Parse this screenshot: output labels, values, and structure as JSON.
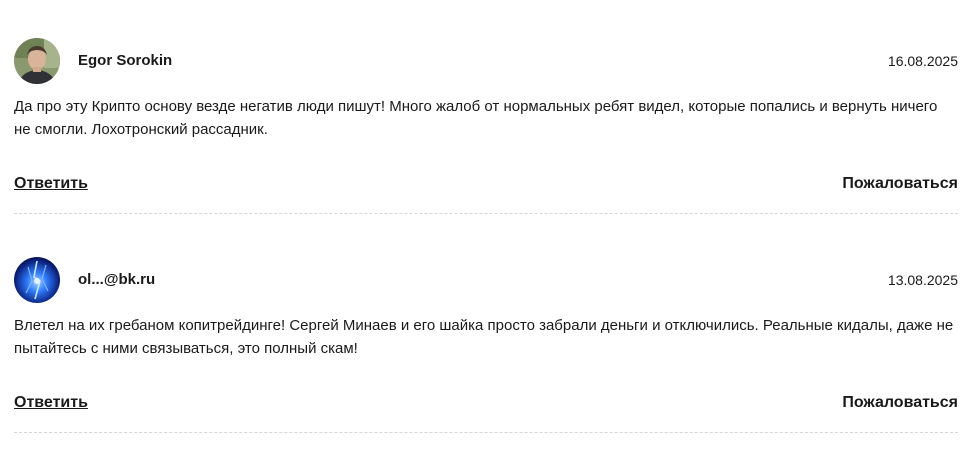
{
  "comments": [
    {
      "author": "Egor Sorokin",
      "date": "16.08.2025",
      "text": "Да про эту Крипто основу везде негатив люди пишут! Много жалоб от нормальных ребят видел, которые попались и вернуть ничего не смогли. Лохотронский рассадник.",
      "reply_label": "Ответить",
      "report_label": "Пожаловаться",
      "avatar_icon": "user-photo-avatar"
    },
    {
      "author": "ol...@bk.ru",
      "date": "13.08.2025",
      "text": "Влетел на их гребаном копитрейдинге! Сергей Минаев и его шайка просто забрали деньги и отключились. Реальные кидалы, даже не пытайтесь с ними связываться, это полный скам!",
      "reply_label": "Ответить",
      "report_label": "Пожаловаться",
      "avatar_icon": "blue-abstract-avatar"
    }
  ]
}
